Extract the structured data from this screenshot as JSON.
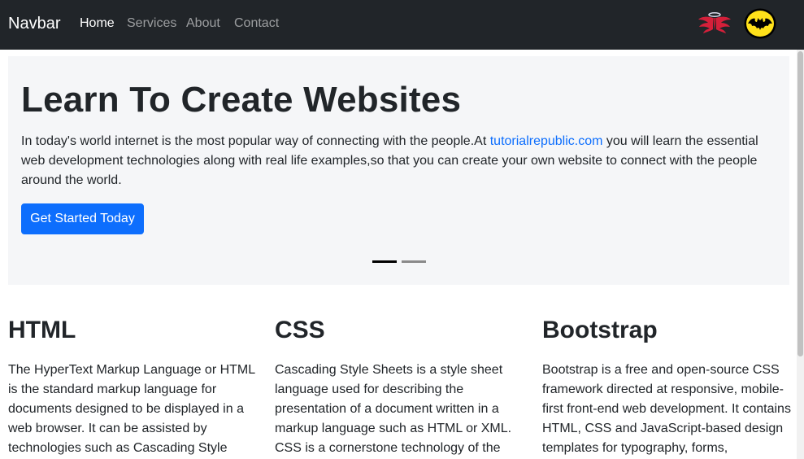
{
  "navbar": {
    "brand": "Navbar",
    "links": [
      {
        "label": "Home",
        "active": true
      },
      {
        "label": "Services",
        "active": false
      },
      {
        "label": "About",
        "active": false
      },
      {
        "label": "Contact",
        "active": false
      }
    ],
    "icons": [
      "wings-logo-icon",
      "bat-logo-icon"
    ]
  },
  "hero": {
    "title": "Learn To Create Websites",
    "text_before_link": "In today's world internet is the most popular way of connecting with the people.At ",
    "link_text": "tutorialrepublic.com",
    "text_after_link": " you will learn the essential web development technologies along with real life examples,so that you can create your own website to connect with the people around the world.",
    "button_label": "Get Started Today",
    "active_slide": 1,
    "slide_count": 2
  },
  "columns": [
    {
      "title": "HTML",
      "text": "The HyperText Markup Language or HTML is the standard markup language for documents designed to be displayed in a web browser. It can be assisted by technologies such as Cascading Style"
    },
    {
      "title": "CSS",
      "text": "Cascading Style Sheets is a style sheet language used for describing the presentation of a document written in a markup language such as HTML or XML. CSS is a cornerstone technology of the"
    },
    {
      "title": "Bootstrap",
      "text": "Bootstrap is a free and open-source CSS framework directed at responsive, mobile-first front-end web development. It contains HTML, CSS and JavaScript-based design templates for typography, forms,"
    }
  ],
  "colors": {
    "navbar_bg": "#212529",
    "primary": "#0d6efd",
    "hero_bg": "#f5f6f8"
  }
}
